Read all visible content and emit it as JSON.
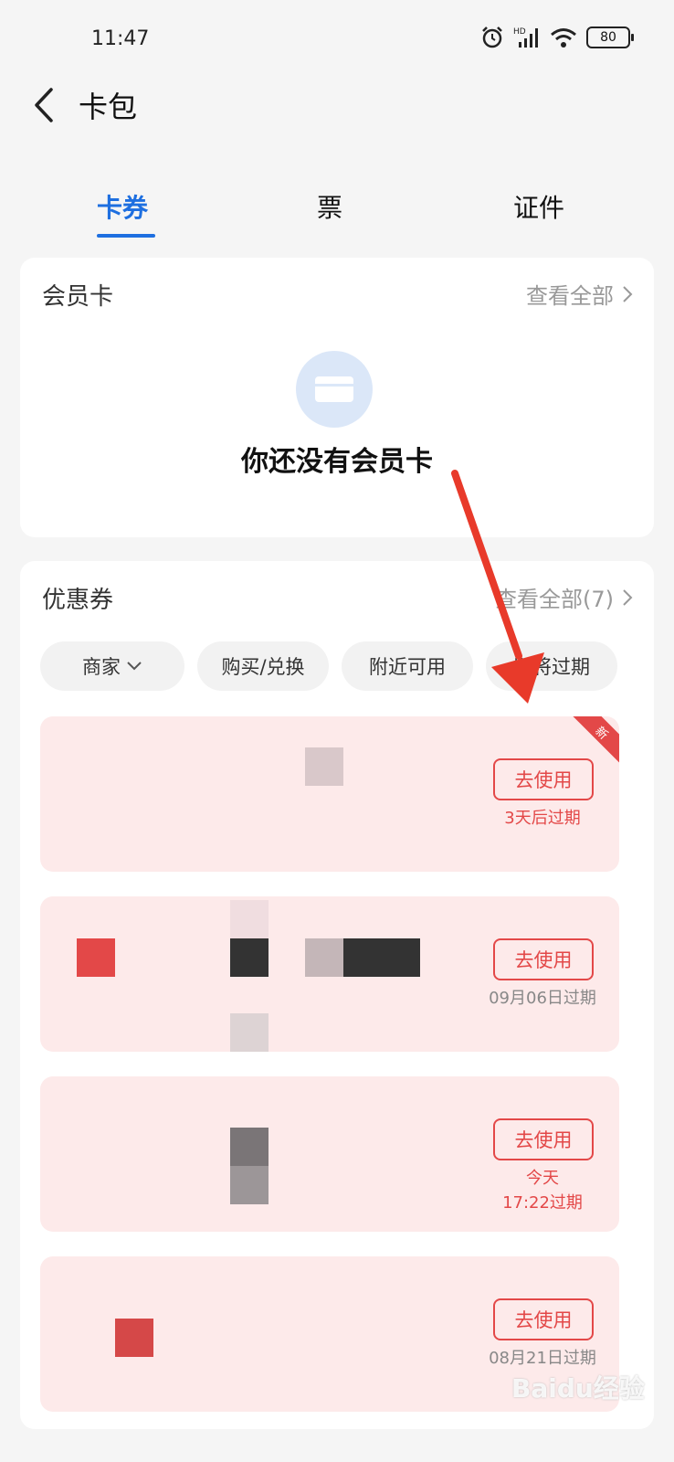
{
  "status": {
    "time": "11:47",
    "battery": "80",
    "signal_label": "HD"
  },
  "header": {
    "title": "卡包"
  },
  "tabs": [
    {
      "label": "卡券",
      "active": true
    },
    {
      "label": "票",
      "active": false
    },
    {
      "label": "证件",
      "active": false
    }
  ],
  "membership": {
    "title": "会员卡",
    "view_all": "查看全部",
    "empty_text": "你还没有会员卡"
  },
  "coupons": {
    "title": "优惠券",
    "view_all": "查看全部(7)",
    "filters": [
      "商家",
      "购买/兑换",
      "附近可用",
      "即将过期"
    ],
    "items": [
      {
        "button": "去使用",
        "expiry": "3天后过期",
        "badge": "新"
      },
      {
        "button": "去使用",
        "expiry": "09月06日过期"
      },
      {
        "button": "去使用",
        "expiry_line1": "今天",
        "expiry_line2": "17:22过期"
      },
      {
        "button": "去使用",
        "expiry": "08月21日过期"
      }
    ]
  },
  "colors": {
    "accent_blue": "#1e6fe0",
    "coupon_red": "#e34848",
    "coupon_bg": "#fdeaea"
  },
  "watermark": "Baidu经验"
}
